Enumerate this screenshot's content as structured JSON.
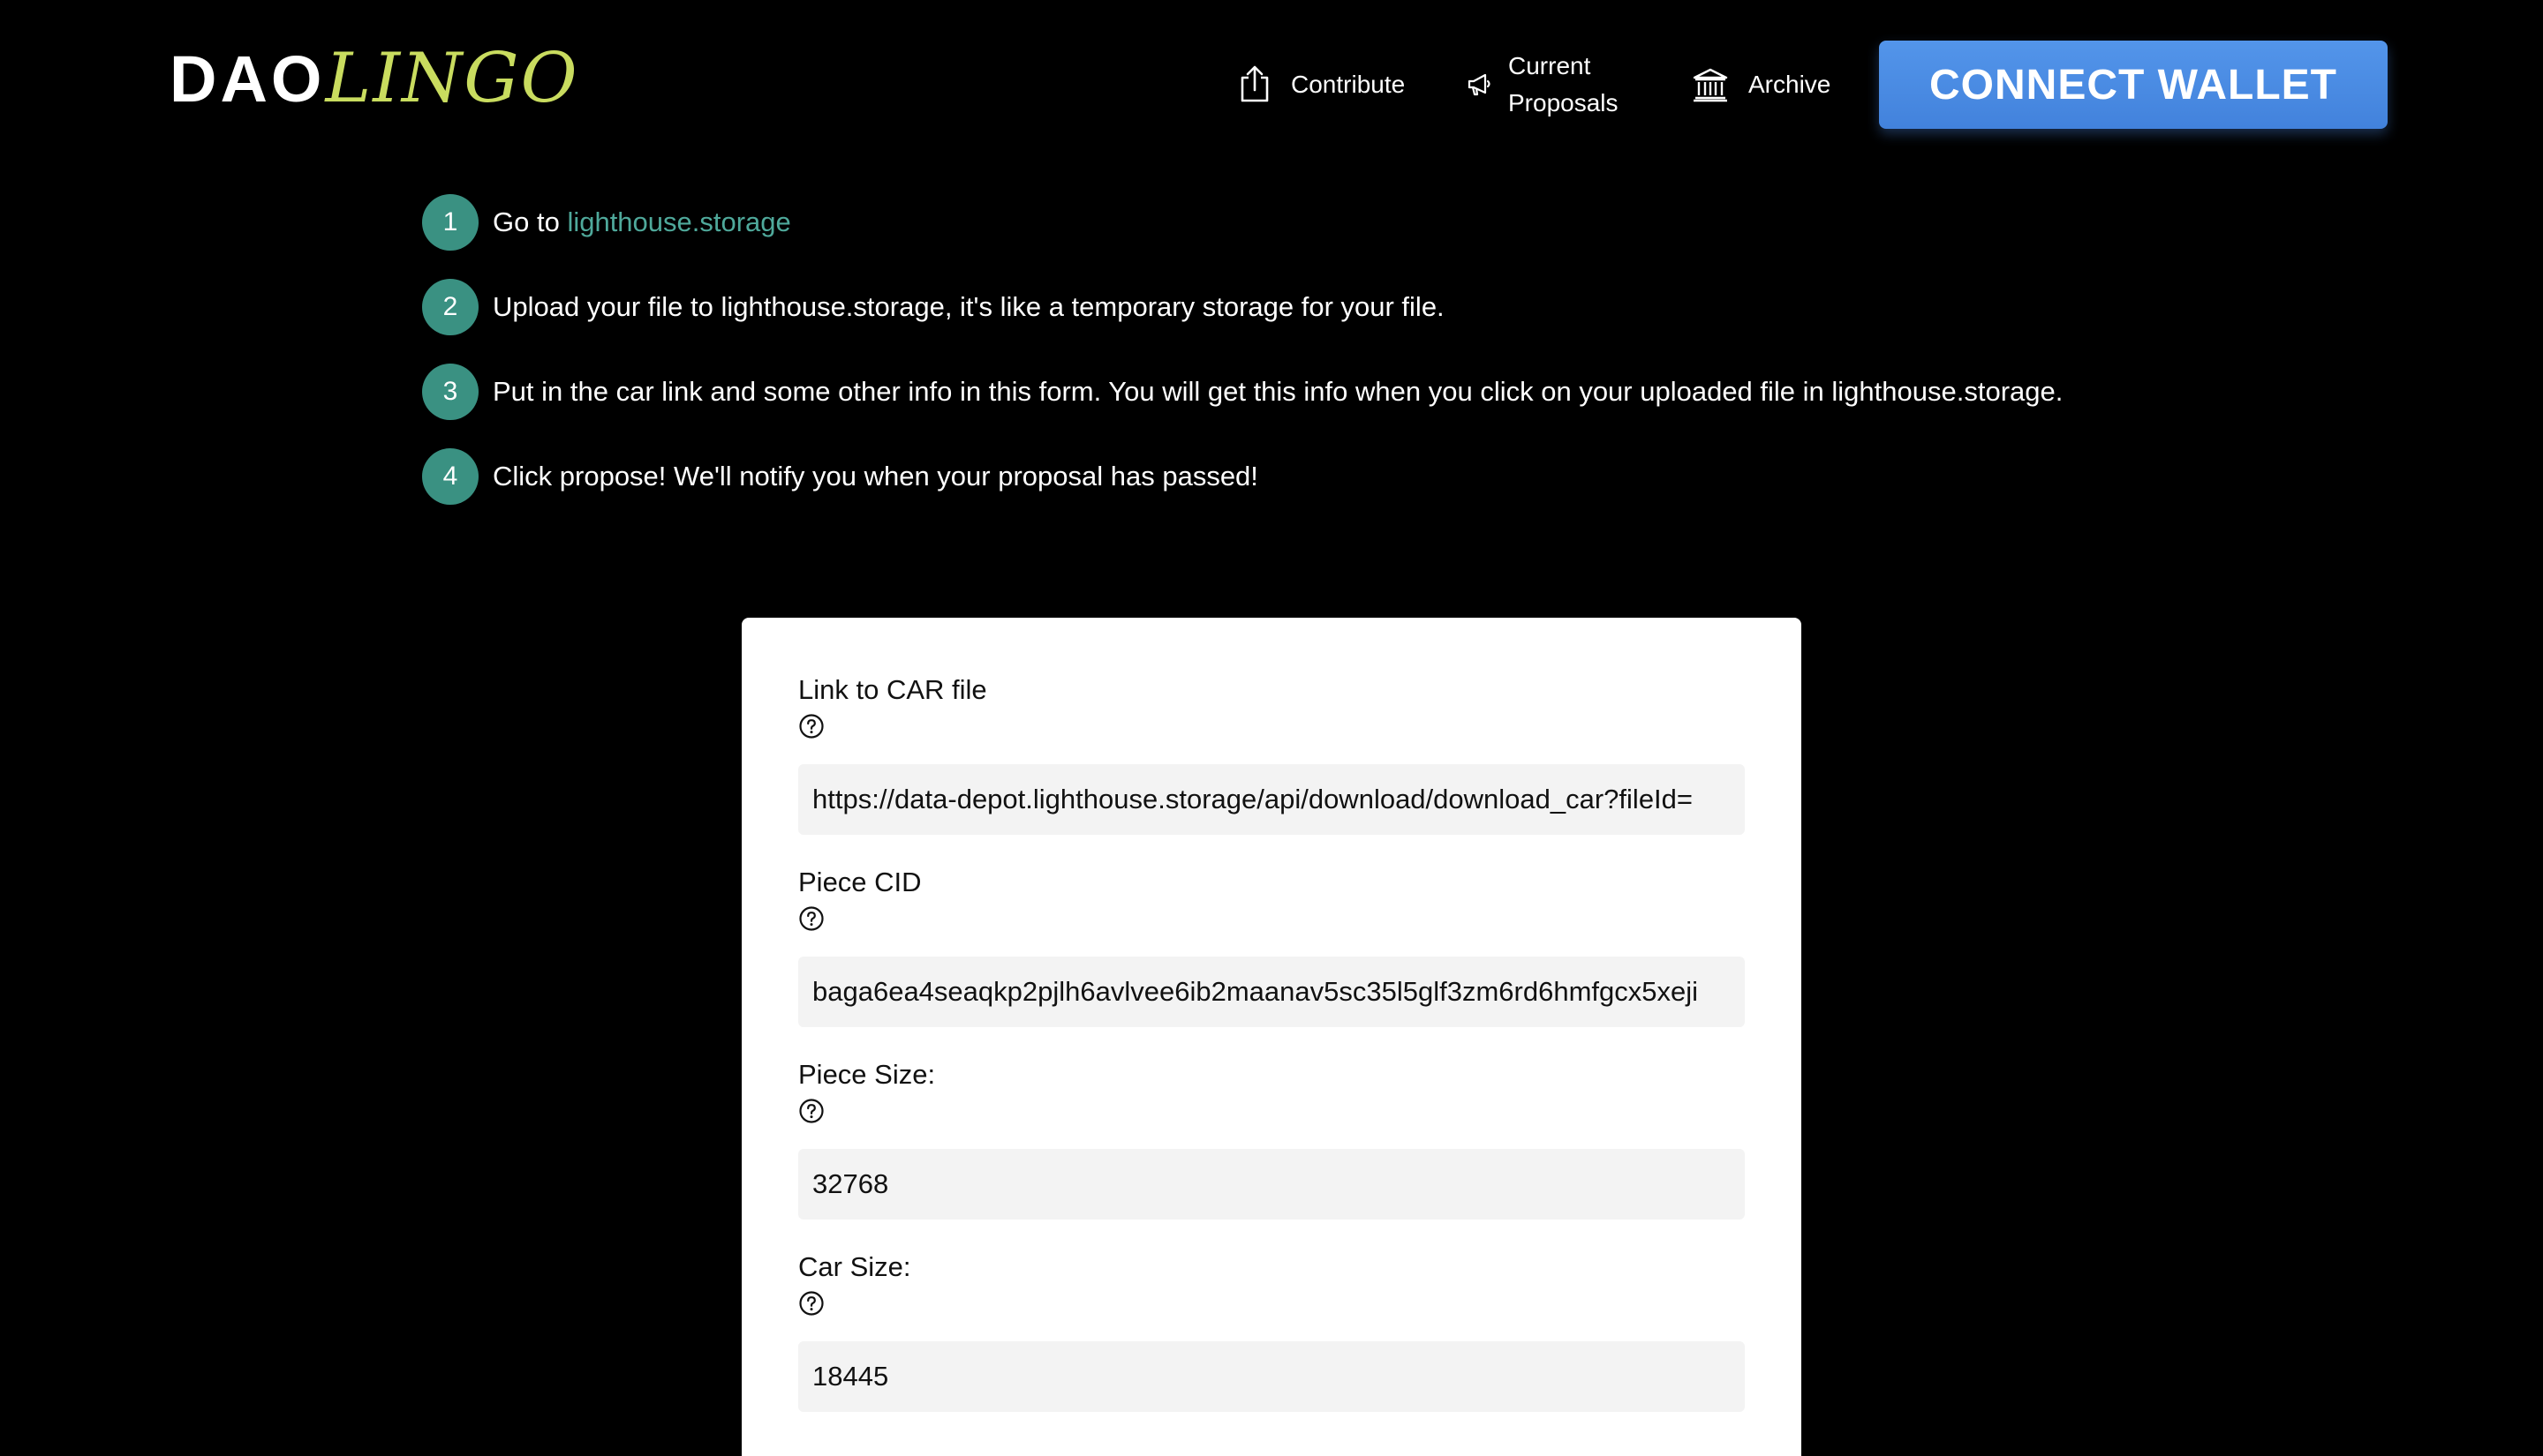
{
  "brand": {
    "part1": "DAO",
    "part2": "LINGO",
    "accent_color": "#c9dc5f"
  },
  "nav": {
    "contribute": {
      "label": "Contribute",
      "icon": "share-upload-icon"
    },
    "proposals": {
      "label_line1": "Current",
      "label_line2": "Proposals",
      "icon": "megaphone-icon"
    },
    "archive": {
      "label": "Archive",
      "icon": "bank-building-icon"
    },
    "connect_wallet": "CONNECT WALLET",
    "connect_color": "#4a88e0"
  },
  "steps": [
    {
      "number": "1",
      "prefix": "Go to ",
      "link": "lighthouse.storage"
    },
    {
      "number": "2",
      "text": "Upload your file to lighthouse.storage, it's like a temporary storage for your file."
    },
    {
      "number": "3",
      "text": "Put in the car link and some other info in this form. You will get this info when you click on your uploaded file in lighthouse.storage."
    },
    {
      "number": "4",
      "text": "Click propose! We'll notify you when your proposal has passed!"
    }
  ],
  "step_color": "#3a9182",
  "form": {
    "car_link": {
      "label": "Link to CAR file",
      "value": "https://data-depot.lighthouse.storage/api/download/download_car?fileId="
    },
    "piece_cid": {
      "label": "Piece CID",
      "value": "baga6ea4seaqkp2pjlh6avlvee6ib2maanav5sc35l5glf3zm6rd6hmfgcx5xeji"
    },
    "piece_size": {
      "label": "Piece Size:",
      "value": "32768"
    },
    "car_size": {
      "label": "Car Size:",
      "value": "18445"
    }
  }
}
